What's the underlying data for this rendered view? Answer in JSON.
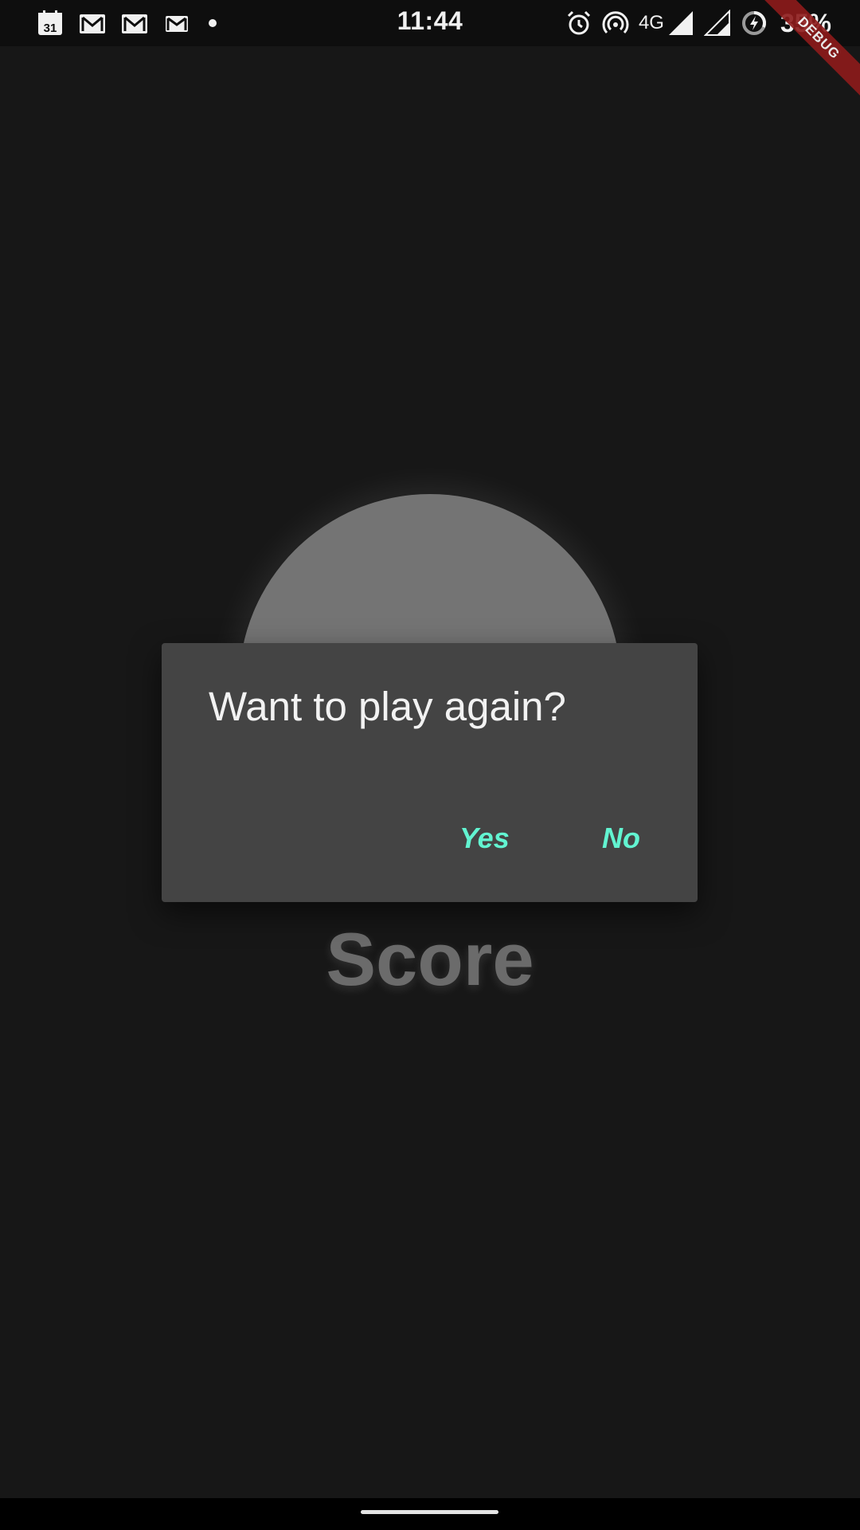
{
  "status_bar": {
    "time": "11:44",
    "network": "4G",
    "battery": "35%",
    "left_icons": [
      "calendar-icon",
      "gmail-icon",
      "gmail-icon",
      "gmail-icon"
    ],
    "calendar_day": "31",
    "right_icons": [
      "alarm-icon",
      "hotspot-icon",
      "signal-icon",
      "signal-icon",
      "battery-saver-icon"
    ]
  },
  "debug_banner": "DEBUG",
  "game": {
    "score_label": "Score"
  },
  "dialog": {
    "title": "Want to play again?",
    "yes_label": "Yes",
    "no_label": "No",
    "accent_color": "#62f4d1"
  },
  "colors": {
    "background": "#171717",
    "dialog_background": "#444444",
    "circle": "#747474",
    "debug_ribbon": "#8e1b1b"
  }
}
